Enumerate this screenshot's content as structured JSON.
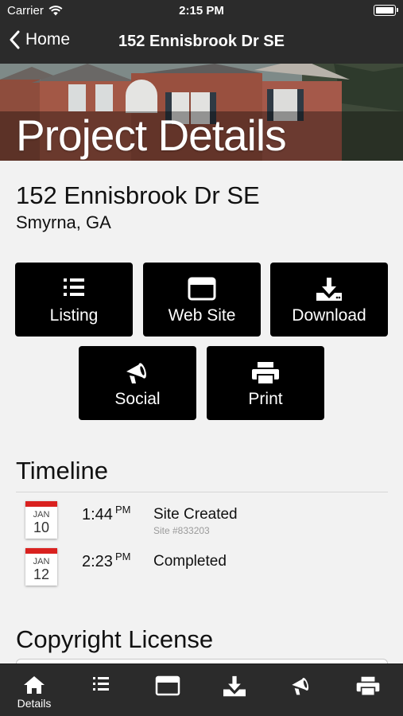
{
  "status_bar": {
    "carrier": "Carrier",
    "time": "2:15 PM"
  },
  "nav": {
    "back_label": "Home",
    "title": "152 Ennisbrook Dr SE"
  },
  "hero": {
    "title": "Project Details"
  },
  "project": {
    "address": "152 Ennisbrook Dr SE",
    "city": "Smyrna, GA"
  },
  "actions": [
    {
      "label": "Listing",
      "icon": "list-icon"
    },
    {
      "label": "Web Site",
      "icon": "browser-window-icon"
    },
    {
      "label": "Download",
      "icon": "download-icon"
    },
    {
      "label": "Social",
      "icon": "megaphone-icon"
    },
    {
      "label": "Print",
      "icon": "printer-icon"
    }
  ],
  "timeline": {
    "heading": "Timeline",
    "items": [
      {
        "month": "JAN",
        "day": "10",
        "time": "1:44",
        "ampm": "PM",
        "title": "Site Created",
        "subtitle": "Site #833203"
      },
      {
        "month": "JAN",
        "day": "12",
        "time": "2:23",
        "ampm": "PM",
        "title": "Completed",
        "subtitle": ""
      }
    ]
  },
  "copyright": {
    "heading": "Copyright License"
  },
  "tab_bar": {
    "active_index": 0,
    "tabs": [
      {
        "label": "Details",
        "icon": "home-icon"
      },
      {
        "label": "",
        "icon": "list-icon"
      },
      {
        "label": "",
        "icon": "browser-window-icon"
      },
      {
        "label": "",
        "icon": "download-icon"
      },
      {
        "label": "",
        "icon": "megaphone-icon"
      },
      {
        "label": "",
        "icon": "printer-icon"
      }
    ]
  },
  "colors": {
    "bar_background": "#2b2b2b",
    "page_background": "#f2f2f2",
    "button_background": "#000000",
    "calendar_accent": "#d9211f"
  }
}
